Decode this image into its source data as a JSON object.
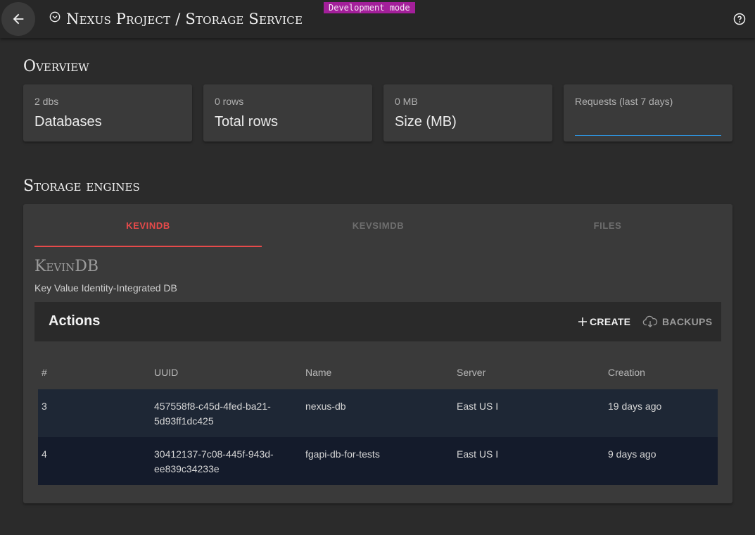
{
  "header": {
    "title": "Nexus Project / Storage Service",
    "dev_badge": "Development mode",
    "back_icon": "arrow-left-icon",
    "title_icon": "chevron-circle-down-icon",
    "help_icon": "help-circle-icon"
  },
  "overview": {
    "title": "Overview",
    "cards": [
      {
        "sub": "2 dbs",
        "main": "Databases"
      },
      {
        "sub": "0 rows",
        "main": "Total rows"
      },
      {
        "sub": "0 MB",
        "main": "Size (MB)"
      },
      {
        "sub": "Requests (last 7 days)",
        "main": ""
      }
    ]
  },
  "storage": {
    "title": "Storage engines",
    "tabs": [
      {
        "label": "KEVINDB",
        "active": true
      },
      {
        "label": "KEVSIMDB",
        "active": false
      },
      {
        "label": "FILES",
        "active": false
      }
    ],
    "engine_name": "KevinDB",
    "engine_description": "Key Value Identity-Integrated DB",
    "actions": {
      "title": "Actions",
      "create_label": "CREATE",
      "backups_label": "BACKUPS"
    },
    "table": {
      "columns": [
        "#",
        "UUID",
        "Name",
        "Server",
        "Creation"
      ],
      "rows": [
        {
          "num": "3",
          "uuid": "457558f8-c45d-4fed-ba21-5d93ff1dc425",
          "name": "nexus-db",
          "server": "East US I",
          "creation": "19 days ago"
        },
        {
          "num": "4",
          "uuid": "30412137-7c08-445f-943d-ee839c34233e",
          "name": "fgapi-db-for-tests",
          "server": "East US I",
          "creation": "9 days ago"
        }
      ]
    }
  },
  "colors": {
    "accent": "#e64a4a",
    "badge": "#a31f9a",
    "input_underline": "#2f8fd6",
    "row1": "#1e2735",
    "row2": "#141b2b"
  }
}
